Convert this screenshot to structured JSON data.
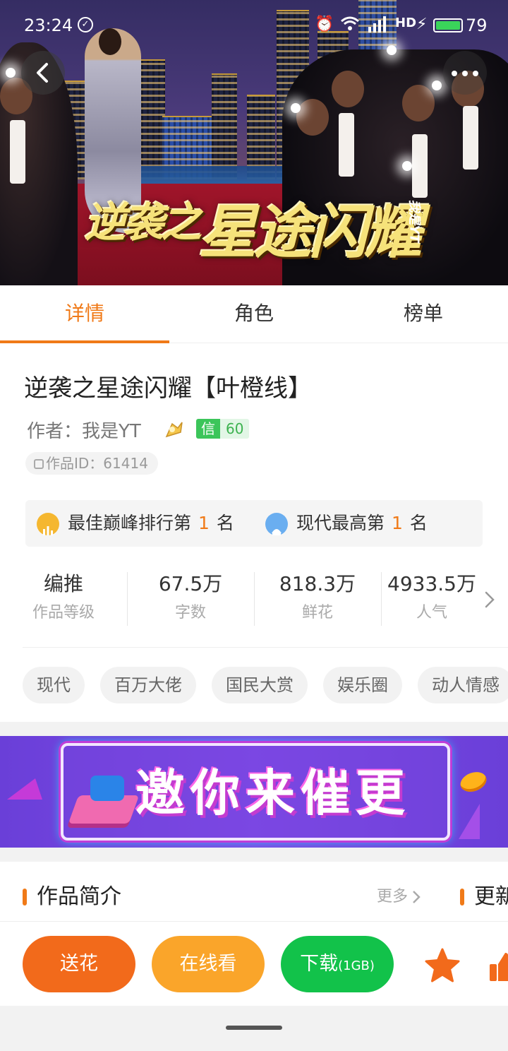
{
  "status_bar": {
    "time": "23:24",
    "battery": "79",
    "network": "4G",
    "hd": "HD"
  },
  "hero": {
    "art_title_small": "逆袭之",
    "art_title_big": "星途闪耀",
    "art_signature": "我是YT",
    "back_icon": "chevron-left-icon",
    "more_icon": "more-dots-icon"
  },
  "tabs": [
    {
      "label": "详情",
      "active": true
    },
    {
      "label": "角色",
      "active": false
    },
    {
      "label": "榜单",
      "active": false
    }
  ],
  "book": {
    "title": "逆袭之星途闪耀【叶橙线】",
    "author_label": "作者：我是YT",
    "credit_label": "信",
    "credit_value": "60",
    "work_id": "作品ID：61414"
  },
  "ranks": [
    {
      "text_before": "最佳巅峰排行第",
      "num": "1",
      "text_after": "名",
      "icon": "chart-icon",
      "color": "#f5b730"
    },
    {
      "text_before": "现代最高第",
      "num": "1",
      "text_after": "名",
      "icon": "badge-icon",
      "color": "#6aaef0"
    }
  ],
  "stats": [
    {
      "value": "编推",
      "label": "作品等级"
    },
    {
      "value": "67.5万",
      "label": "字数"
    },
    {
      "value": "818.3万",
      "label": "鲜花"
    },
    {
      "value": "4933.5万",
      "label": "人气"
    }
  ],
  "tags": [
    "现代",
    "百万大佬",
    "国民大赏",
    "娱乐圈",
    "动人情感"
  ],
  "banner": {
    "text": "邀你来催更"
  },
  "section": {
    "title": "作品简介",
    "more": "更多",
    "title2": "更新"
  },
  "actions": {
    "flower": "送花",
    "read_online": "在线看",
    "download": "下载",
    "download_size": "(1GB)"
  },
  "colors": {
    "accent": "#f07a18",
    "flower_btn": "#f26a1b",
    "read_btn": "#faa52a",
    "download_btn": "#12c24a",
    "banner_bg": "#7d49e6"
  }
}
